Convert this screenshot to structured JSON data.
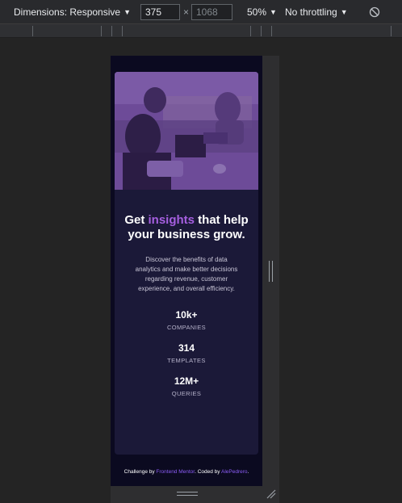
{
  "devtools": {
    "dimensions_label": "Dimensions: Responsive",
    "width_value": "375",
    "height_placeholder": "1068",
    "times": "×",
    "zoom": "50%",
    "throttling": "No throttling",
    "rotate_icon": "rotate-icon"
  },
  "page": {
    "headline_pre": "Get ",
    "headline_accent": "insights",
    "headline_post": " that help your business grow.",
    "description": "Discover the benefits of data analytics and make better decisions regarding revenue, customer experience, and overall efficiency.",
    "stats": [
      {
        "value": "10k+",
        "label": "COMPANIES"
      },
      {
        "value": "314",
        "label": "TEMPLATES"
      },
      {
        "value": "12M+",
        "label": "QUERIES"
      }
    ],
    "accent_color": "#a65fe0",
    "card_color": "#1b1938",
    "background_color": "#0b0a20"
  },
  "attribution": {
    "prefix": "Challenge by ",
    "link1": "Frontend Mentor",
    "middle": ". Coded by ",
    "link2": "AlePedrero",
    "suffix": "."
  }
}
